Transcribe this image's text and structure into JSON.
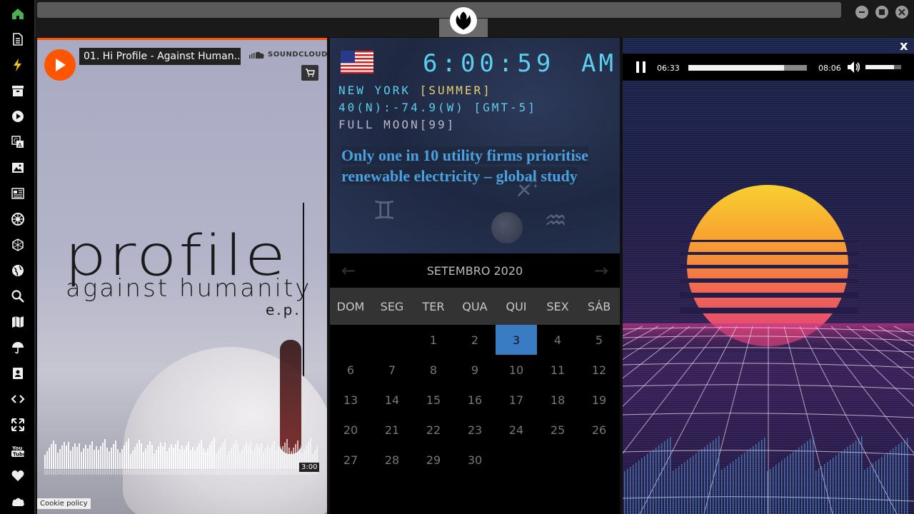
{
  "sidebar": {
    "items": [
      {
        "icon": "home-icon",
        "color": "#4caf50"
      },
      {
        "icon": "document-icon"
      },
      {
        "icon": "lightning-icon",
        "color": "#f0c020"
      },
      {
        "icon": "archive-icon"
      },
      {
        "icon": "play-circle-icon"
      },
      {
        "icon": "translate-icon"
      },
      {
        "icon": "image-icon"
      },
      {
        "icon": "news-icon"
      },
      {
        "icon": "empire-icon"
      },
      {
        "icon": "hexagon-icon"
      },
      {
        "icon": "globe-icon"
      },
      {
        "icon": "search-icon"
      },
      {
        "icon": "map-icon"
      },
      {
        "icon": "umbrella-icon"
      },
      {
        "icon": "contact-card-icon"
      },
      {
        "icon": "code-icon"
      },
      {
        "icon": "expand-icon"
      },
      {
        "icon": "youtube-icon"
      },
      {
        "icon": "heart-icon"
      },
      {
        "icon": "cloud-icon"
      }
    ]
  },
  "soundcloud": {
    "track_title": "01. Hi Profile - Against Human...",
    "brand": "SOUNDCLOUD",
    "album_title": "profile",
    "album_subtitle": "against humanity",
    "album_ep": "e.p.",
    "wave_time": "3:00",
    "cookie_policy": "Cookie policy",
    "accent": "#ff5500"
  },
  "clock": {
    "time": "6:00:59",
    "ampm": "AM",
    "city": "NEW YORK ",
    "season": "[SUMMER]",
    "coords": "40(N):-74.9(W) [GMT-5]",
    "moon": "FULL MOON[99]",
    "headline": "Only one in 10 utility firms prioritise renewable electricity – global study",
    "digit_color": "#5ad0ee"
  },
  "calendar": {
    "month": "SETEMBRO 2020",
    "weekdays": [
      "DOM",
      "SEG",
      "TER",
      "QUA",
      "QUI",
      "SEX",
      "SÁB"
    ],
    "today": "3",
    "weeks": [
      [
        "",
        "",
        "1",
        "2",
        "3",
        "4",
        "5"
      ],
      [
        "6",
        "7",
        "8",
        "9",
        "10",
        "11",
        "12"
      ],
      [
        "13",
        "14",
        "15",
        "16",
        "17",
        "18",
        "19"
      ],
      [
        "20",
        "21",
        "22",
        "23",
        "24",
        "25",
        "26"
      ],
      [
        "27",
        "28",
        "29",
        "30",
        "",
        "",
        ""
      ]
    ],
    "today_color": "#3a7cc4"
  },
  "video": {
    "current_time": "06:33",
    "duration": "08:06",
    "progress": 0.81,
    "volume": 0.8,
    "close": "x"
  }
}
